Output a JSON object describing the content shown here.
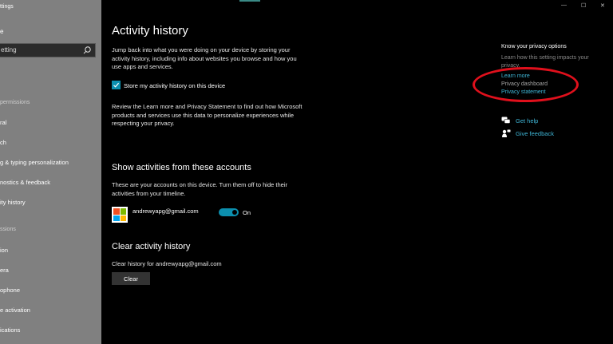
{
  "window": {
    "title": "ttings",
    "controls": [
      "—",
      "☐",
      "✕"
    ]
  },
  "sidebar": {
    "home_label": "e",
    "search": {
      "value": "etting"
    },
    "section_windows": "permissions",
    "items_windows": [
      "ral",
      "ch",
      "g & typing personalization",
      "nostics & feedback",
      "ity history"
    ],
    "section_app": "ssions",
    "items_app": [
      "ion",
      "era",
      "ophone",
      "e activation",
      "ications"
    ]
  },
  "main": {
    "title": "Activity history",
    "intro": [
      "Jump back into what you were doing on your device by storing your",
      "activity history, including info about websites you browse and how you",
      "use apps and services."
    ],
    "checkbox_label": "Store my activity history on this device",
    "review": [
      "Review the Learn more and Privacy Statement to find out how Microsoft",
      "products and services use this data to personalize experiences while",
      "respecting your privacy."
    ],
    "accounts_heading": "Show activities from these accounts",
    "accounts_desc": [
      "These are your accounts on this device. Turn them off to hide their",
      "activities from your timeline."
    ],
    "account_email": "andrewyapg@gmail.com",
    "toggle_state": "On",
    "clear_heading": "Clear activity history",
    "clear_desc": "Clear history for andrewyapg@gmail.com",
    "clear_button": "Clear"
  },
  "right": {
    "heading": "Know your privacy options",
    "desc": "Learn how this setting impacts your privacy.",
    "learn_more": "Learn more",
    "privacy_dashboard": "Privacy dashboard",
    "privacy_statement": "Privacy statement",
    "get_help": "Get help",
    "give_feedback": "Give feedback"
  },
  "colors": {
    "accent": "#0c8fae",
    "link": "#3fb6d6",
    "annotation": "#e0101c"
  }
}
